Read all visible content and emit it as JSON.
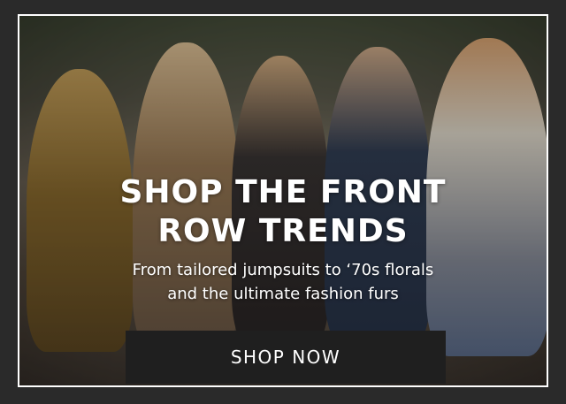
{
  "banner": {
    "headline_line1": "SHOP THE FRONT",
    "headline_line2": "ROW TRENDS",
    "subcopy_line1": "From tailored jumpsuits to ‘70s florals",
    "subcopy_line2": "and the ultimate fashion furs",
    "cta_label": "SHOP NOW"
  },
  "colors": {
    "page_background": "#2a2a2a",
    "frame_border": "#ffffff",
    "cta_background": "#1f1f1f",
    "text": "#ffffff"
  }
}
